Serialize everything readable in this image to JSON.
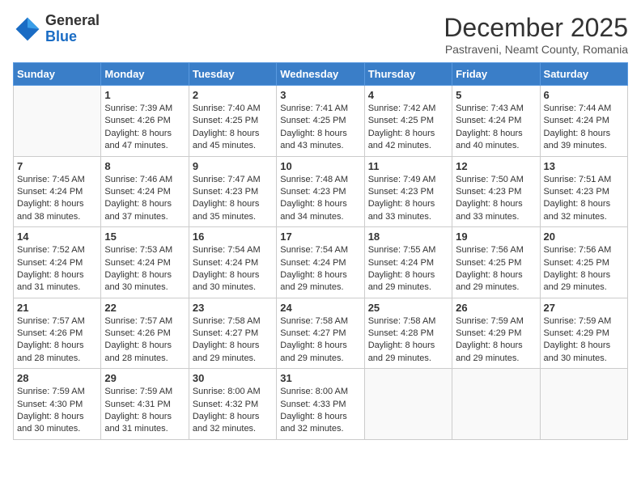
{
  "header": {
    "logo_line1": "General",
    "logo_line2": "Blue",
    "month_title": "December 2025",
    "subtitle": "Pastraveni, Neamt County, Romania"
  },
  "weekdays": [
    "Sunday",
    "Monday",
    "Tuesday",
    "Wednesday",
    "Thursday",
    "Friday",
    "Saturday"
  ],
  "weeks": [
    [
      {
        "day": "",
        "sunrise": "",
        "sunset": "",
        "daylight": ""
      },
      {
        "day": "1",
        "sunrise": "Sunrise: 7:39 AM",
        "sunset": "Sunset: 4:26 PM",
        "daylight": "Daylight: 8 hours and 47 minutes."
      },
      {
        "day": "2",
        "sunrise": "Sunrise: 7:40 AM",
        "sunset": "Sunset: 4:25 PM",
        "daylight": "Daylight: 8 hours and 45 minutes."
      },
      {
        "day": "3",
        "sunrise": "Sunrise: 7:41 AM",
        "sunset": "Sunset: 4:25 PM",
        "daylight": "Daylight: 8 hours and 43 minutes."
      },
      {
        "day": "4",
        "sunrise": "Sunrise: 7:42 AM",
        "sunset": "Sunset: 4:25 PM",
        "daylight": "Daylight: 8 hours and 42 minutes."
      },
      {
        "day": "5",
        "sunrise": "Sunrise: 7:43 AM",
        "sunset": "Sunset: 4:24 PM",
        "daylight": "Daylight: 8 hours and 40 minutes."
      },
      {
        "day": "6",
        "sunrise": "Sunrise: 7:44 AM",
        "sunset": "Sunset: 4:24 PM",
        "daylight": "Daylight: 8 hours and 39 minutes."
      }
    ],
    [
      {
        "day": "7",
        "sunrise": "Sunrise: 7:45 AM",
        "sunset": "Sunset: 4:24 PM",
        "daylight": "Daylight: 8 hours and 38 minutes."
      },
      {
        "day": "8",
        "sunrise": "Sunrise: 7:46 AM",
        "sunset": "Sunset: 4:24 PM",
        "daylight": "Daylight: 8 hours and 37 minutes."
      },
      {
        "day": "9",
        "sunrise": "Sunrise: 7:47 AM",
        "sunset": "Sunset: 4:23 PM",
        "daylight": "Daylight: 8 hours and 35 minutes."
      },
      {
        "day": "10",
        "sunrise": "Sunrise: 7:48 AM",
        "sunset": "Sunset: 4:23 PM",
        "daylight": "Daylight: 8 hours and 34 minutes."
      },
      {
        "day": "11",
        "sunrise": "Sunrise: 7:49 AM",
        "sunset": "Sunset: 4:23 PM",
        "daylight": "Daylight: 8 hours and 33 minutes."
      },
      {
        "day": "12",
        "sunrise": "Sunrise: 7:50 AM",
        "sunset": "Sunset: 4:23 PM",
        "daylight": "Daylight: 8 hours and 33 minutes."
      },
      {
        "day": "13",
        "sunrise": "Sunrise: 7:51 AM",
        "sunset": "Sunset: 4:23 PM",
        "daylight": "Daylight: 8 hours and 32 minutes."
      }
    ],
    [
      {
        "day": "14",
        "sunrise": "Sunrise: 7:52 AM",
        "sunset": "Sunset: 4:24 PM",
        "daylight": "Daylight: 8 hours and 31 minutes."
      },
      {
        "day": "15",
        "sunrise": "Sunrise: 7:53 AM",
        "sunset": "Sunset: 4:24 PM",
        "daylight": "Daylight: 8 hours and 30 minutes."
      },
      {
        "day": "16",
        "sunrise": "Sunrise: 7:54 AM",
        "sunset": "Sunset: 4:24 PM",
        "daylight": "Daylight: 8 hours and 30 minutes."
      },
      {
        "day": "17",
        "sunrise": "Sunrise: 7:54 AM",
        "sunset": "Sunset: 4:24 PM",
        "daylight": "Daylight: 8 hours and 29 minutes."
      },
      {
        "day": "18",
        "sunrise": "Sunrise: 7:55 AM",
        "sunset": "Sunset: 4:24 PM",
        "daylight": "Daylight: 8 hours and 29 minutes."
      },
      {
        "day": "19",
        "sunrise": "Sunrise: 7:56 AM",
        "sunset": "Sunset: 4:25 PM",
        "daylight": "Daylight: 8 hours and 29 minutes."
      },
      {
        "day": "20",
        "sunrise": "Sunrise: 7:56 AM",
        "sunset": "Sunset: 4:25 PM",
        "daylight": "Daylight: 8 hours and 29 minutes."
      }
    ],
    [
      {
        "day": "21",
        "sunrise": "Sunrise: 7:57 AM",
        "sunset": "Sunset: 4:26 PM",
        "daylight": "Daylight: 8 hours and 28 minutes."
      },
      {
        "day": "22",
        "sunrise": "Sunrise: 7:57 AM",
        "sunset": "Sunset: 4:26 PM",
        "daylight": "Daylight: 8 hours and 28 minutes."
      },
      {
        "day": "23",
        "sunrise": "Sunrise: 7:58 AM",
        "sunset": "Sunset: 4:27 PM",
        "daylight": "Daylight: 8 hours and 29 minutes."
      },
      {
        "day": "24",
        "sunrise": "Sunrise: 7:58 AM",
        "sunset": "Sunset: 4:27 PM",
        "daylight": "Daylight: 8 hours and 29 minutes."
      },
      {
        "day": "25",
        "sunrise": "Sunrise: 7:58 AM",
        "sunset": "Sunset: 4:28 PM",
        "daylight": "Daylight: 8 hours and 29 minutes."
      },
      {
        "day": "26",
        "sunrise": "Sunrise: 7:59 AM",
        "sunset": "Sunset: 4:29 PM",
        "daylight": "Daylight: 8 hours and 29 minutes."
      },
      {
        "day": "27",
        "sunrise": "Sunrise: 7:59 AM",
        "sunset": "Sunset: 4:29 PM",
        "daylight": "Daylight: 8 hours and 30 minutes."
      }
    ],
    [
      {
        "day": "28",
        "sunrise": "Sunrise: 7:59 AM",
        "sunset": "Sunset: 4:30 PM",
        "daylight": "Daylight: 8 hours and 30 minutes."
      },
      {
        "day": "29",
        "sunrise": "Sunrise: 7:59 AM",
        "sunset": "Sunset: 4:31 PM",
        "daylight": "Daylight: 8 hours and 31 minutes."
      },
      {
        "day": "30",
        "sunrise": "Sunrise: 8:00 AM",
        "sunset": "Sunset: 4:32 PM",
        "daylight": "Daylight: 8 hours and 32 minutes."
      },
      {
        "day": "31",
        "sunrise": "Sunrise: 8:00 AM",
        "sunset": "Sunset: 4:33 PM",
        "daylight": "Daylight: 8 hours and 32 minutes."
      },
      {
        "day": "",
        "sunrise": "",
        "sunset": "",
        "daylight": ""
      },
      {
        "day": "",
        "sunrise": "",
        "sunset": "",
        "daylight": ""
      },
      {
        "day": "",
        "sunrise": "",
        "sunset": "",
        "daylight": ""
      }
    ]
  ]
}
